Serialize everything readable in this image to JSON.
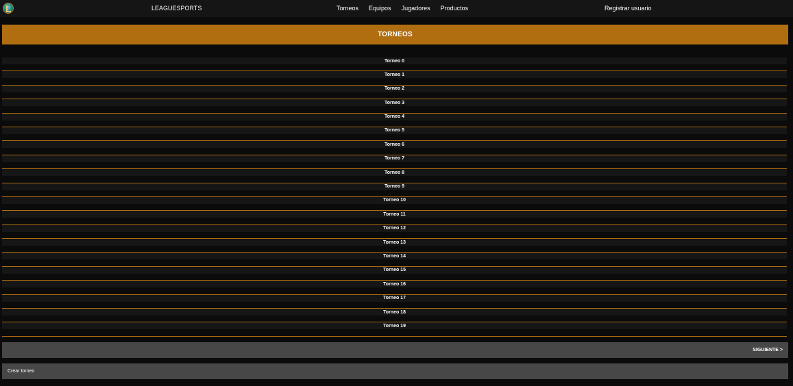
{
  "navbar": {
    "brand": "LEAGUESPORTS",
    "links": [
      "Torneos",
      "Equipos",
      "Jugadores",
      "Productos"
    ],
    "register": "Registrar usuario"
  },
  "header": {
    "title": "TORNEOS"
  },
  "tournaments": [
    "Torneo 0",
    "Torneo 1",
    "Torneo 2",
    "Torneo 3",
    "Torneo 4",
    "Torneo 5",
    "Torneo 6",
    "Torneo 7",
    "Torneo 8",
    "Torneo 9",
    "Torneo 10",
    "Torneo 11",
    "Torneo 12",
    "Torneo 13",
    "Torneo 14",
    "Torneo 15",
    "Torneo 16",
    "Torneo 17",
    "Torneo 18",
    "Torneo 19"
  ],
  "pager": {
    "next": "SIGUIENTE >"
  },
  "actions": {
    "create": "Crear torneo"
  },
  "colors": {
    "accent": "#b06e11",
    "background": "#0b0b0b",
    "panel": "#474747"
  }
}
